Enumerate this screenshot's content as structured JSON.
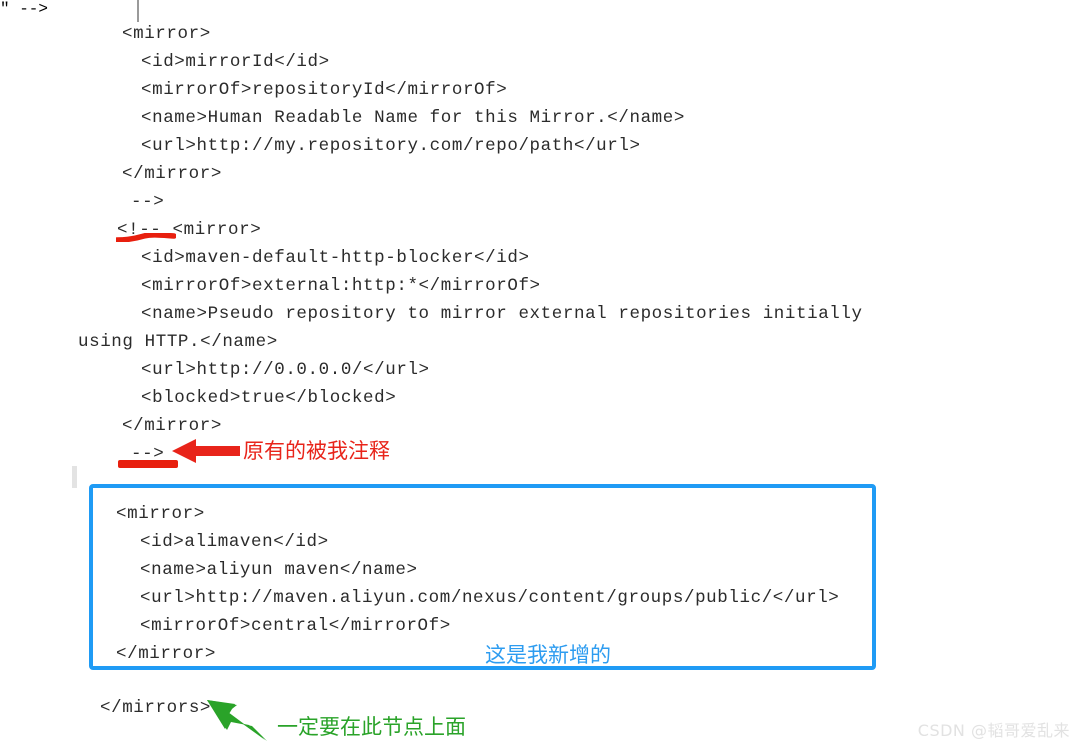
{
  "document": {
    "type": "xml-code-snippet",
    "description": "Maven settings.xml mirrors configuration with handwritten annotations",
    "text_color": "#2b2b2b",
    "background": "#ffffff"
  },
  "code": {
    "lines": [
      {
        "indent": 2,
        "text": "<mirror>"
      },
      {
        "indent": 4,
        "text": "<id>mirrorId</id>"
      },
      {
        "indent": 4,
        "text": "<mirrorOf>repositoryId</mirrorOf>"
      },
      {
        "indent": 4,
        "text": "<name>Human Readable Name for this Mirror.</name>"
      },
      {
        "indent": 4,
        "text": "<url>http://my.repository.com/repo/path</url>"
      },
      {
        "indent": 2,
        "text": "</mirror>"
      },
      {
        "indent": 3,
        "text": "-->"
      },
      {
        "indent": 2,
        "text": "<!-- <mirror>"
      },
      {
        "indent": 4,
        "text": "<id>maven-default-http-blocker</id>"
      },
      {
        "indent": 4,
        "text": "<mirrorOf>external:http:*</mirrorOf>"
      },
      {
        "indent": 4,
        "text": "<name>Pseudo repository to mirror external repositories initially"
      },
      {
        "indent": 0,
        "text": "using HTTP.</name>"
      },
      {
        "indent": 4,
        "text": "<url>http://0.0.0.0/</url>"
      },
      {
        "indent": 4,
        "text": "<blocked>true</blocked>"
      },
      {
        "indent": 2,
        "text": "</mirror>"
      },
      {
        "indent": 3,
        "text": "-->"
      }
    ]
  },
  "highlight_box": {
    "border_color": "#1f9bf5",
    "lines": [
      {
        "indent": 1,
        "text": "<mirror>"
      },
      {
        "indent": 3,
        "text": "<id>alimaven</id>"
      },
      {
        "indent": 3,
        "text": "<name>aliyun maven</name>"
      },
      {
        "indent": 3,
        "text": "<url>http://maven.aliyun.com/nexus/content/groups/public/</url>"
      },
      {
        "indent": 3,
        "text": "<mirrorOf>central</mirrorOf>"
      },
      {
        "indent": 1,
        "text": "</mirror>"
      }
    ]
  },
  "closing": {
    "line": "</mirrors>"
  },
  "annotations": {
    "red": {
      "text": "原有的被我注释",
      "color": "#e8241a",
      "arrow_direction": "left",
      "underline_color": "#e81f0e"
    },
    "blue": {
      "text": "这是我新增的",
      "color": "#2d9cf0"
    },
    "green": {
      "text": "一定要在此节点上面",
      "color": "#2aa329",
      "arrow_direction": "up-left"
    }
  },
  "watermark": {
    "text": "CSDN @韬哥爱乱来",
    "color": "#e2e2e2"
  }
}
